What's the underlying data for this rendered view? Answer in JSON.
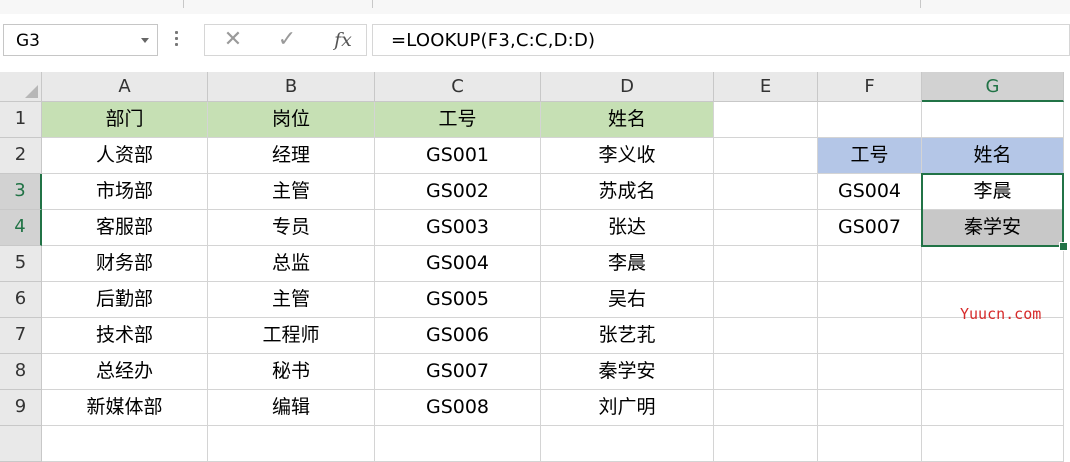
{
  "name_box": {
    "value": "G3"
  },
  "formula_bar": {
    "cancel_glyph": "✕",
    "enter_glyph": "✓",
    "fx_label": "fx",
    "formula": "=LOOKUP(F3,C:C,D:D)"
  },
  "columns": [
    "A",
    "B",
    "C",
    "D",
    "E",
    "F",
    "G"
  ],
  "selected_column": "G",
  "rows": [
    "1",
    "2",
    "3",
    "4",
    "5",
    "6",
    "7",
    "8",
    "9"
  ],
  "selected_rows": [
    "3",
    "4"
  ],
  "table": {
    "headers": [
      "部门",
      "岗位",
      "工号",
      "姓名"
    ],
    "data": [
      [
        "人资部",
        "经理",
        "GS001",
        "李义收"
      ],
      [
        "市场部",
        "主管",
        "GS002",
        "苏成名"
      ],
      [
        "客服部",
        "专员",
        "GS003",
        "张达"
      ],
      [
        "财务部",
        "总监",
        "GS004",
        "李晨"
      ],
      [
        "后勤部",
        "主管",
        "GS005",
        "吴右"
      ],
      [
        "技术部",
        "工程师",
        "GS006",
        "张艺芤"
      ],
      [
        "总经办",
        "秘书",
        "GS007",
        "秦学安"
      ],
      [
        "新媒体部",
        "编辑",
        "GS008",
        "刘广明"
      ]
    ]
  },
  "lookup": {
    "headers": [
      "工号",
      "姓名"
    ],
    "data": [
      [
        "GS004",
        "李晨"
      ],
      [
        "GS007",
        "秦学安"
      ]
    ]
  },
  "colors": {
    "header_green": "#c6e0b4",
    "header_blue": "#b4c6e7",
    "selection_green": "#217346",
    "active_gray": "#c8c8c8"
  },
  "watermark": "Yuucn.com"
}
